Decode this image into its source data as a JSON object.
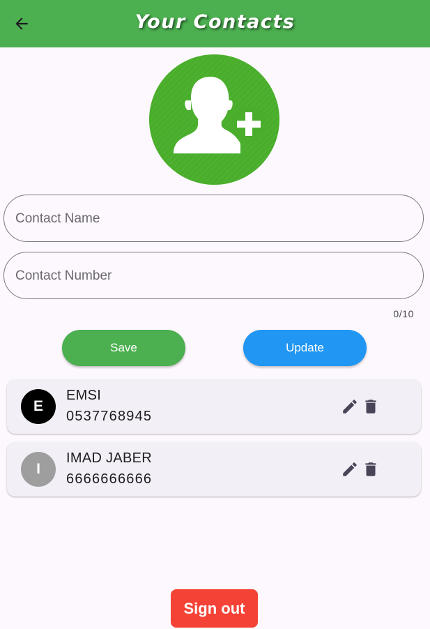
{
  "appbar": {
    "title": "Your Contacts",
    "back_icon": "arrow-left-icon",
    "color": "#4caf50"
  },
  "avatar": {
    "icon": "add-person-icon",
    "color": "#4aae2c"
  },
  "form": {
    "name_placeholder": "Contact Name",
    "number_placeholder": "Contact Number",
    "counter": "0/10"
  },
  "buttons": {
    "save_label": "Save",
    "save_color": "#4caf50",
    "update_label": "Update",
    "update_color": "#2196f3"
  },
  "contacts": [
    {
      "initial": "E",
      "name": "EMSI",
      "number": "0537768945",
      "avatar_color": "#000000"
    },
    {
      "initial": "I",
      "name": "IMAD JABER",
      "number": "6666666666",
      "avatar_color": "#9e9e9e"
    }
  ],
  "footer": {
    "signout_label": "Sign out",
    "signout_color": "#f44336"
  }
}
